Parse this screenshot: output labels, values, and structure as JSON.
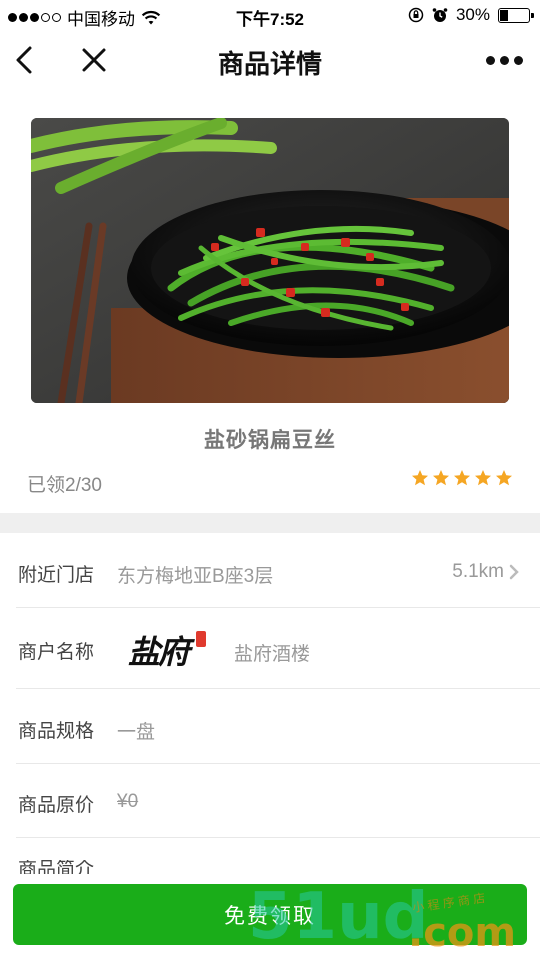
{
  "status_bar": {
    "carrier": "中国移动",
    "time": "下午7:52",
    "battery": "30%",
    "battery_level": 0.3,
    "icons": [
      "signal-icon",
      "wifi-icon",
      "orientation-lock-icon",
      "alarm-icon",
      "battery-icon"
    ]
  },
  "nav": {
    "title": "商品详情",
    "icons": [
      "back-icon",
      "close-icon",
      "more-icon"
    ]
  },
  "product": {
    "name": "盐砂锅扁豆丝",
    "claimed": "已领2/30",
    "rating": 5,
    "rating_max": 5,
    "star_color": "#f5a623"
  },
  "info": {
    "store_label": "附近门店",
    "store_value": "东方梅地亚B座3层",
    "store_distance": "5.1km",
    "merchant_label": "商户名称",
    "merchant_logo_text": "盐府",
    "merchant_name": "盐府酒楼",
    "spec_label": "商品规格",
    "spec_value": "一盘",
    "price_label": "商品原价",
    "price_value": "¥0",
    "intro_label": "商品简介"
  },
  "action": {
    "claim_label": "免费领取",
    "button_color": "#1aad19"
  },
  "watermark": {
    "brand": "51ud",
    "domain": ".com",
    "tagline": "小 程 序 商 店"
  }
}
